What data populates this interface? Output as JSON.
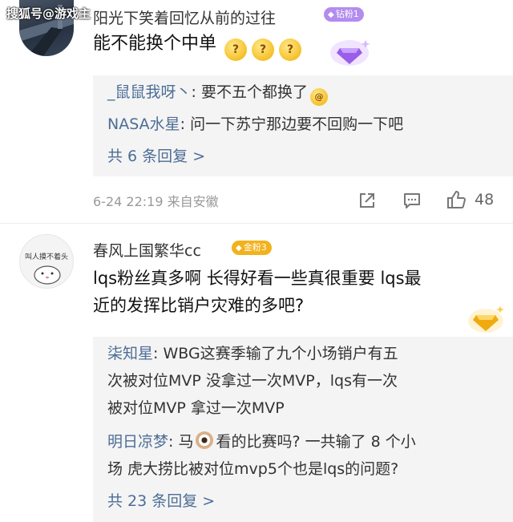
{
  "watermark": "搜狐号@游戏主",
  "comments": [
    {
      "username": "阳光下笑着回忆从前的过往",
      "badge": "钻粉1",
      "badge_color": "#b38cf0",
      "text": "能不能换个中单",
      "emoji_glyph": "?",
      "replies": [
        {
          "name": "_鼠鼠我呀丶",
          "text": ": 要不五个都换了"
        },
        {
          "name": "NASA水星",
          "text": ": 问一下苏宁那边要不回购一下吧"
        }
      ],
      "more": "共 6 条回复 >",
      "time": "6-24 22:19 来自安徽",
      "likes": "48"
    },
    {
      "username": "春风上国繁华cc",
      "badge": "金粉3",
      "badge_color": "#f2b21c",
      "avatar_text": "叫人摸不着头",
      "text_line1": "lqs粉丝真多啊 长得好看一些真很重要 lqs最",
      "text_line2": "近的发挥比销户灾难的多吧?",
      "replies": [
        {
          "name": "柒知星",
          "lines": [
            ": WBG这赛季输了九个小场销户有五",
            "次被对位MVP 没拿过一次MVP，lqs有一次",
            "被对位MVP  拿过一次MVP"
          ]
        },
        {
          "name": "明日凉梦",
          "pre": ": 马",
          "post": "看的比赛吗? 一共输了 8 个小",
          "line2": "场 虎大捞比被对位mvp5个也是lqs的问题?"
        }
      ],
      "more": "共 23 条回复 >"
    }
  ]
}
